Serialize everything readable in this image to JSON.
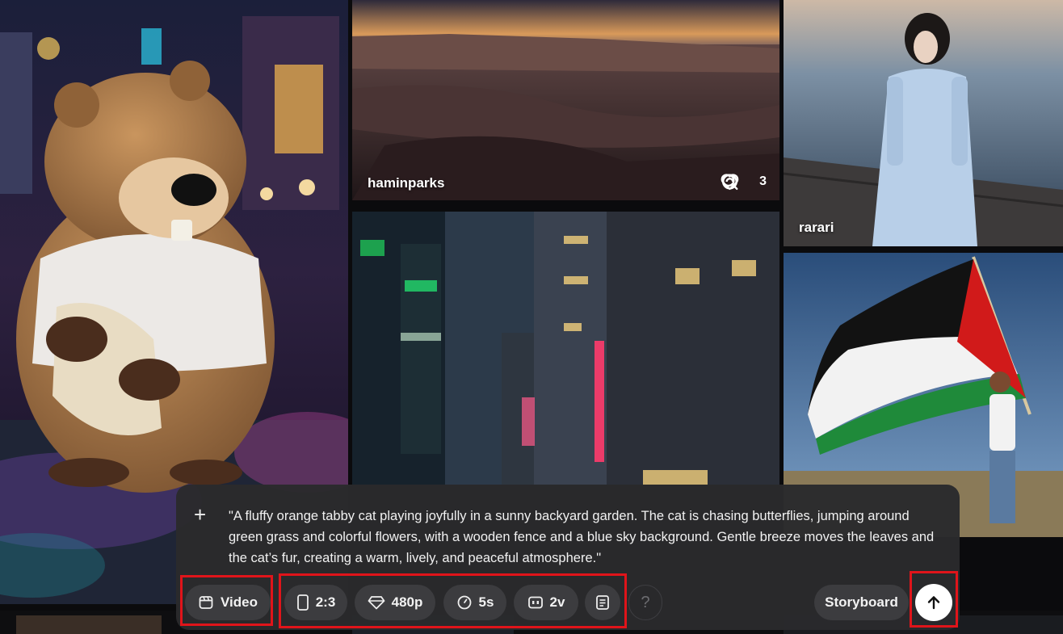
{
  "gallery": {
    "canyon_card": {
      "author": "haminparks",
      "likes": "3",
      "icons": [
        "remix-icon",
        "search-icon",
        "heart-icon"
      ]
    },
    "girl_card": {
      "author": "rarari"
    }
  },
  "composer": {
    "plus_icon": "+",
    "prompt": "\"A fluffy orange tabby cat playing joyfully in a sunny backyard garden. The cat is chasing butterflies, jumping around green grass and colorful flowers, with a wooden fence and a blue sky background. Gentle breeze moves the leaves and the cat’s fur, creating a warm, lively, and peaceful atmosphere.\"",
    "type_label": "Video",
    "ratio_label": "2:3",
    "resolution_label": "480p",
    "duration_label": "5s",
    "variations_label": "2v",
    "help_label": "?",
    "storyboard_label": "Storyboard"
  },
  "colors": {
    "highlight": "#e0141a",
    "chip_bg": "#3c3c3f",
    "panel_bg": "#2a2a2c"
  }
}
